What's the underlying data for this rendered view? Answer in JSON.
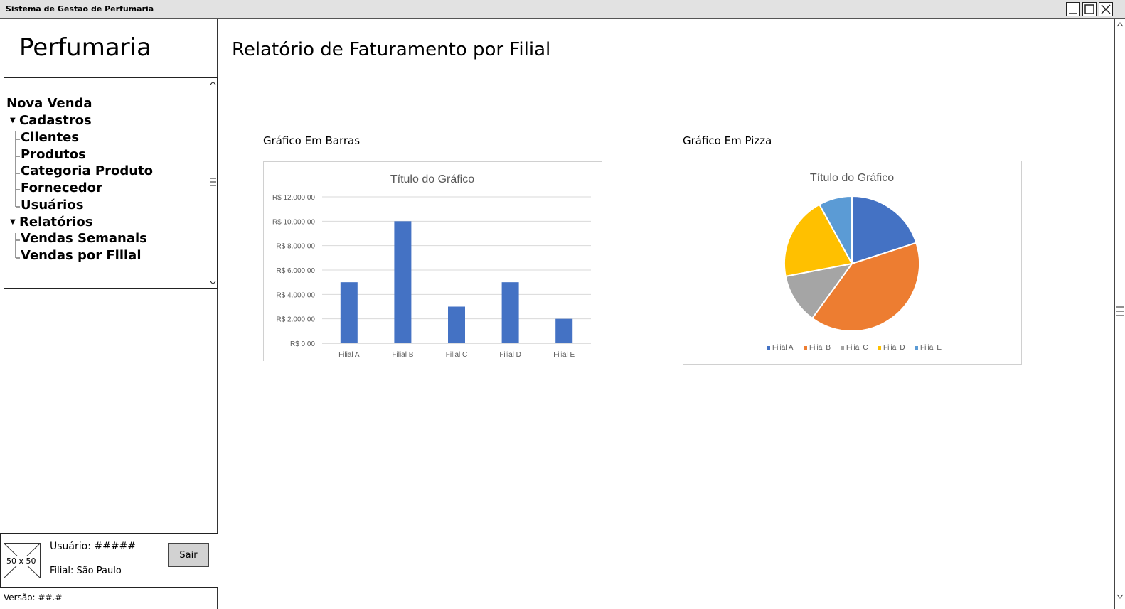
{
  "window": {
    "title": "Sistema de Gestão de Perfumaria"
  },
  "sidebar": {
    "app_name": "Perfumaria",
    "nav": {
      "new_sale": "Nova Venda",
      "cadastros": "Cadastros",
      "clientes": "Clientes",
      "produtos": "Produtos",
      "categoria": "Categoria Produto",
      "fornecedor": "Fornecedor",
      "usuarios": "Usuários",
      "relatorios": "Relatórios",
      "vendas_semanais": "Vendas Semanais",
      "vendas_filial": "Vendas por Filial"
    },
    "user": {
      "avatar_placeholder": "50 x 50",
      "user_label": "Usuário: #####",
      "branch_label": "Filial: São Paulo",
      "logout": "Sair"
    },
    "version": "Versão: ##.#"
  },
  "main": {
    "title": "Relatório de Faturamento por Filial",
    "bar_section": "Gráfico Em Barras",
    "pie_section": "Gráfico Em Pizza"
  },
  "chart_data": [
    {
      "type": "bar",
      "title": "Título do Gráfico",
      "categories": [
        "Filial A",
        "Filial B",
        "Filial C",
        "Filial D",
        "Filial E"
      ],
      "values": [
        5000,
        10000,
        3000,
        5000,
        2000
      ],
      "ylim": [
        0,
        12000
      ],
      "yticks": [
        "R$ 0,00",
        "R$ 2.000,00",
        "R$ 4.000,00",
        "R$ 6.000,00",
        "R$ 8.000,00",
        "R$ 10.000,00",
        "R$ 12.000,00"
      ],
      "grid": true,
      "color": "#4472C4"
    },
    {
      "type": "pie",
      "title": "Título do Gráfico",
      "categories": [
        "Filial A",
        "Filial B",
        "Filial C",
        "Filial D",
        "Filial E"
      ],
      "values": [
        5000,
        10000,
        3000,
        5000,
        2000
      ],
      "colors": [
        "#4472C4",
        "#ED7D31",
        "#A5A5A5",
        "#FFC000",
        "#5B9BD5"
      ],
      "legend": "bottom"
    }
  ]
}
